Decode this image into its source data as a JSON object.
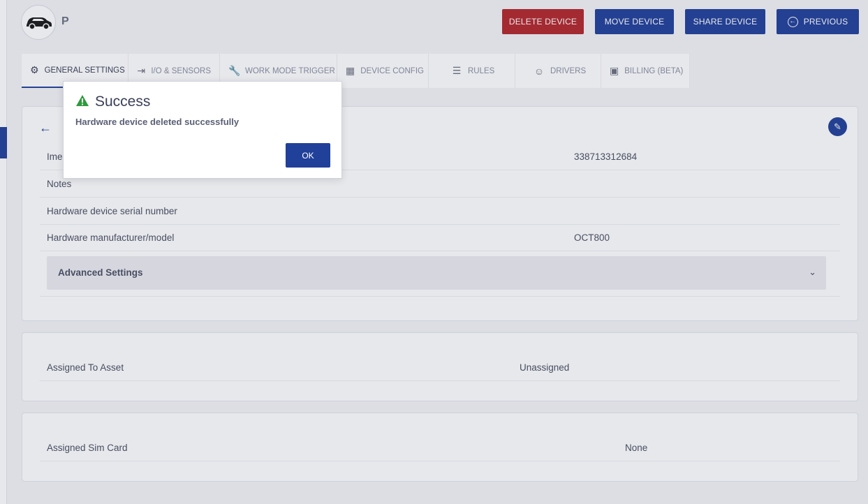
{
  "device": {
    "name": "P",
    "avatar_icon": "car-icon"
  },
  "actions": {
    "delete_label": "DELETE DEVICE",
    "move_label": "MOVE DEVICE",
    "share_label": "SHARE DEVICE",
    "previous_label": "PREVIOUS"
  },
  "tabs": [
    {
      "label": "GENERAL SETTINGS",
      "icon": "gear-icon"
    },
    {
      "label": "I/O & SENSORS",
      "icon": "login-icon"
    },
    {
      "label": "WORK MODE TRIGGER",
      "icon": "wrench-icon"
    },
    {
      "label": "DEVICE CONFIG",
      "icon": "table-icon"
    },
    {
      "label": "RULES",
      "icon": "list-icon"
    },
    {
      "label": "DRIVERS",
      "icon": "user-icon"
    },
    {
      "label": "BILLING (BETA)",
      "icon": "wallet-icon"
    }
  ],
  "details": {
    "imei_label": "Ime",
    "imei_value": "338713312684",
    "notes_label": "Notes",
    "serial_label": "Hardware device serial number",
    "model_label": "Hardware manufacturer/model",
    "model_value": "OCT800",
    "advanced_label": "Advanced Settings"
  },
  "asset": {
    "label": "Assigned To Asset",
    "value": "Unassigned"
  },
  "sim": {
    "label": "Assigned Sim Card",
    "value": "None"
  },
  "modal": {
    "title": "Success",
    "message": "Hardware device deleted successfully",
    "ok_label": "OK",
    "icon_color": "#2e9a3e"
  },
  "colors": {
    "primary": "#21409a",
    "danger": "#b3272d"
  }
}
